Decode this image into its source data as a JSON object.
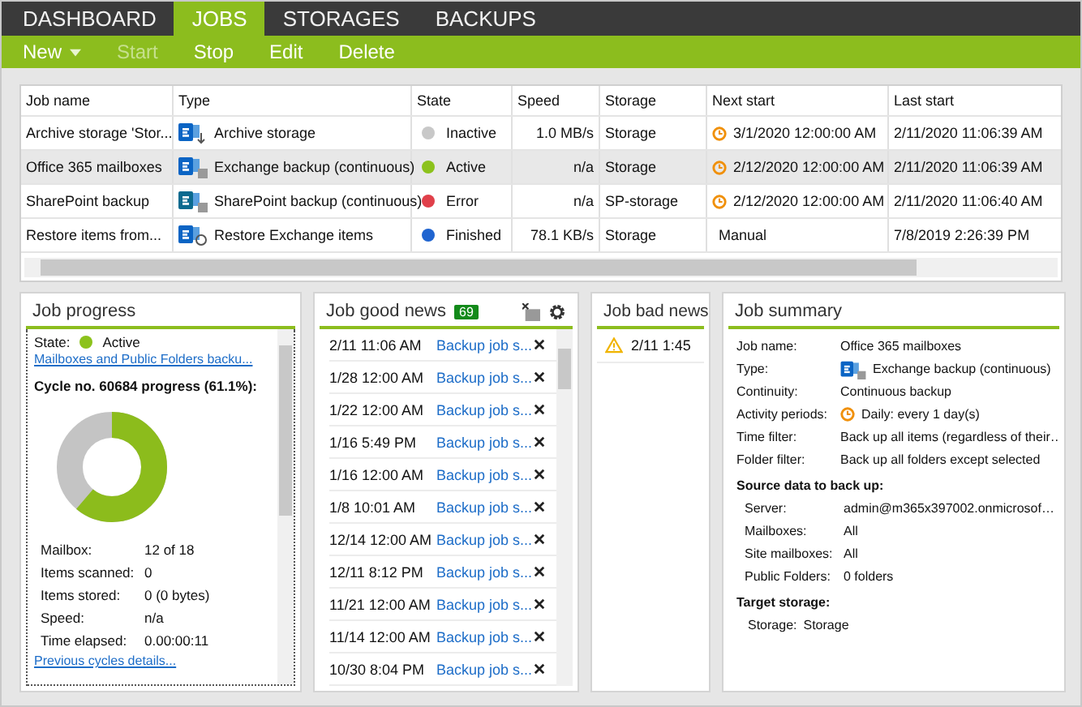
{
  "tabs": [
    {
      "label": "DASHBOARD",
      "selected": false
    },
    {
      "label": "JOBS",
      "selected": true
    },
    {
      "label": "STORAGES",
      "selected": false
    },
    {
      "label": "BACKUPS",
      "selected": false
    }
  ],
  "toolbar": [
    {
      "label": "New",
      "disabled": false,
      "dropdown": true
    },
    {
      "label": "Start",
      "disabled": true,
      "dropdown": false
    },
    {
      "label": "Stop",
      "disabled": false,
      "dropdown": false
    },
    {
      "label": "Edit",
      "disabled": false,
      "dropdown": false
    },
    {
      "label": "Delete",
      "disabled": false,
      "dropdown": false
    }
  ],
  "table": {
    "columns": [
      "Job name",
      "Type",
      "State",
      "Speed",
      "Storage",
      "Next start",
      "Last start"
    ],
    "rows": [
      {
        "name": "Archive storage 'Stor...",
        "kind": "archive",
        "type": "Archive storage",
        "state": "Inactive",
        "color": "#c8c8c8",
        "speed": "1.0 MB/s",
        "storage": "Storage",
        "scheduled": true,
        "next_start": "3/1/2020 12:00:00 AM",
        "last_start": "2/11/2020 11:06:39 AM",
        "selected": false
      },
      {
        "name": "Office 365 mailboxes",
        "kind": "exchange",
        "type": "Exchange backup (continuous)",
        "state": "Active",
        "color": "#8cc21c",
        "speed": "n/a",
        "storage": "Storage",
        "scheduled": true,
        "next_start": "2/12/2020 12:00:00 AM",
        "last_start": "2/11/2020 11:06:39 AM",
        "selected": true
      },
      {
        "name": "SharePoint backup",
        "kind": "sharepoint",
        "type": "SharePoint backup (continuous)",
        "state": "Error",
        "color": "#e0404a",
        "speed": "n/a",
        "storage": "SP-storage",
        "scheduled": true,
        "next_start": "2/12/2020 12:00:00 AM",
        "last_start": "2/11/2020 11:06:40 AM",
        "selected": false
      },
      {
        "name": "Restore items from...",
        "kind": "restore",
        "type": "Restore Exchange items",
        "state": "Finished",
        "color": "#1f64d0",
        "speed": "78.1 KB/s",
        "storage": "Storage",
        "scheduled": false,
        "next_start": "Manual",
        "last_start": "7/8/2019 2:26:39 PM",
        "selected": false
      }
    ]
  },
  "job_progress": {
    "title": "Job progress",
    "state_label": "State:",
    "state": "Active",
    "link": "Mailboxes and Public Folders backu...",
    "cycle": "Cycle no. 60684 progress (61.1%):",
    "level": 0.611,
    "stats": [
      {
        "label": "Mailbox:",
        "value": "12 of 18"
      },
      {
        "label": "Items scanned:",
        "value": "0"
      },
      {
        "label": "Items stored:",
        "value": "0 (0 bytes)"
      },
      {
        "label": "Speed:",
        "value": "n/a"
      },
      {
        "label": "Time elapsed:",
        "value": "0.00:00:11"
      }
    ],
    "footer_link": "Previous cycles details..."
  },
  "good_news": {
    "title": "Job good news",
    "count": "69",
    "items": [
      {
        "time": "2/11 11:06 AM",
        "text": "Backup job s..."
      },
      {
        "time": "1/28 12:00 AM",
        "text": "Backup job s..."
      },
      {
        "time": "1/22 12:00 AM",
        "text": "Backup job s..."
      },
      {
        "time": "1/16 5:49 PM",
        "text": "Backup job s..."
      },
      {
        "time": "1/16 12:00 AM",
        "text": "Backup job s..."
      },
      {
        "time": "1/8 10:01 AM",
        "text": "Backup job s..."
      },
      {
        "time": "12/14 12:00 AM",
        "text": "Backup job s..."
      },
      {
        "time": "12/11 8:12 PM",
        "text": "Backup job s..."
      },
      {
        "time": "11/21 12:00 AM",
        "text": "Backup job s..."
      },
      {
        "time": "11/14 12:00 AM",
        "text": "Backup job s..."
      },
      {
        "time": "10/30 8:04 PM",
        "text": "Backup job s..."
      }
    ]
  },
  "bad_news": {
    "title": "Job bad news",
    "items": [
      {
        "time": "2/11 1:45"
      }
    ]
  },
  "summary": {
    "title": "Job summary",
    "rows": [
      {
        "kind": "row",
        "label": "Job name:",
        "value": "Office 365 mailboxes"
      },
      {
        "kind": "type",
        "label": "Type:",
        "value": "Exchange backup (continuous)"
      },
      {
        "kind": "row",
        "label": "Continuity:",
        "value": "Continuous backup"
      },
      {
        "kind": "clock",
        "label": "Activity periods:",
        "value": "Daily: every 1 day(s)"
      },
      {
        "kind": "row",
        "label": "Time filter:",
        "value": "Back up all items (regardless of their…"
      },
      {
        "kind": "row",
        "label": "Folder filter:",
        "value": "Back up all folders except selected"
      },
      {
        "kind": "heading",
        "label": "Source data to back up:"
      },
      {
        "kind": "sub",
        "label": "Server:",
        "value": "admin@m365x397002.onmicrosof…"
      },
      {
        "kind": "sub",
        "label": "Mailboxes:",
        "value": "All"
      },
      {
        "kind": "sub",
        "label": "Site mailboxes:",
        "value": "All"
      },
      {
        "kind": "sub",
        "label": "Public Folders:",
        "value": "0 folders"
      },
      {
        "kind": "heading",
        "label": "Target storage:"
      },
      {
        "kind": "pair",
        "label": "Storage:",
        "value": "Storage"
      }
    ]
  }
}
